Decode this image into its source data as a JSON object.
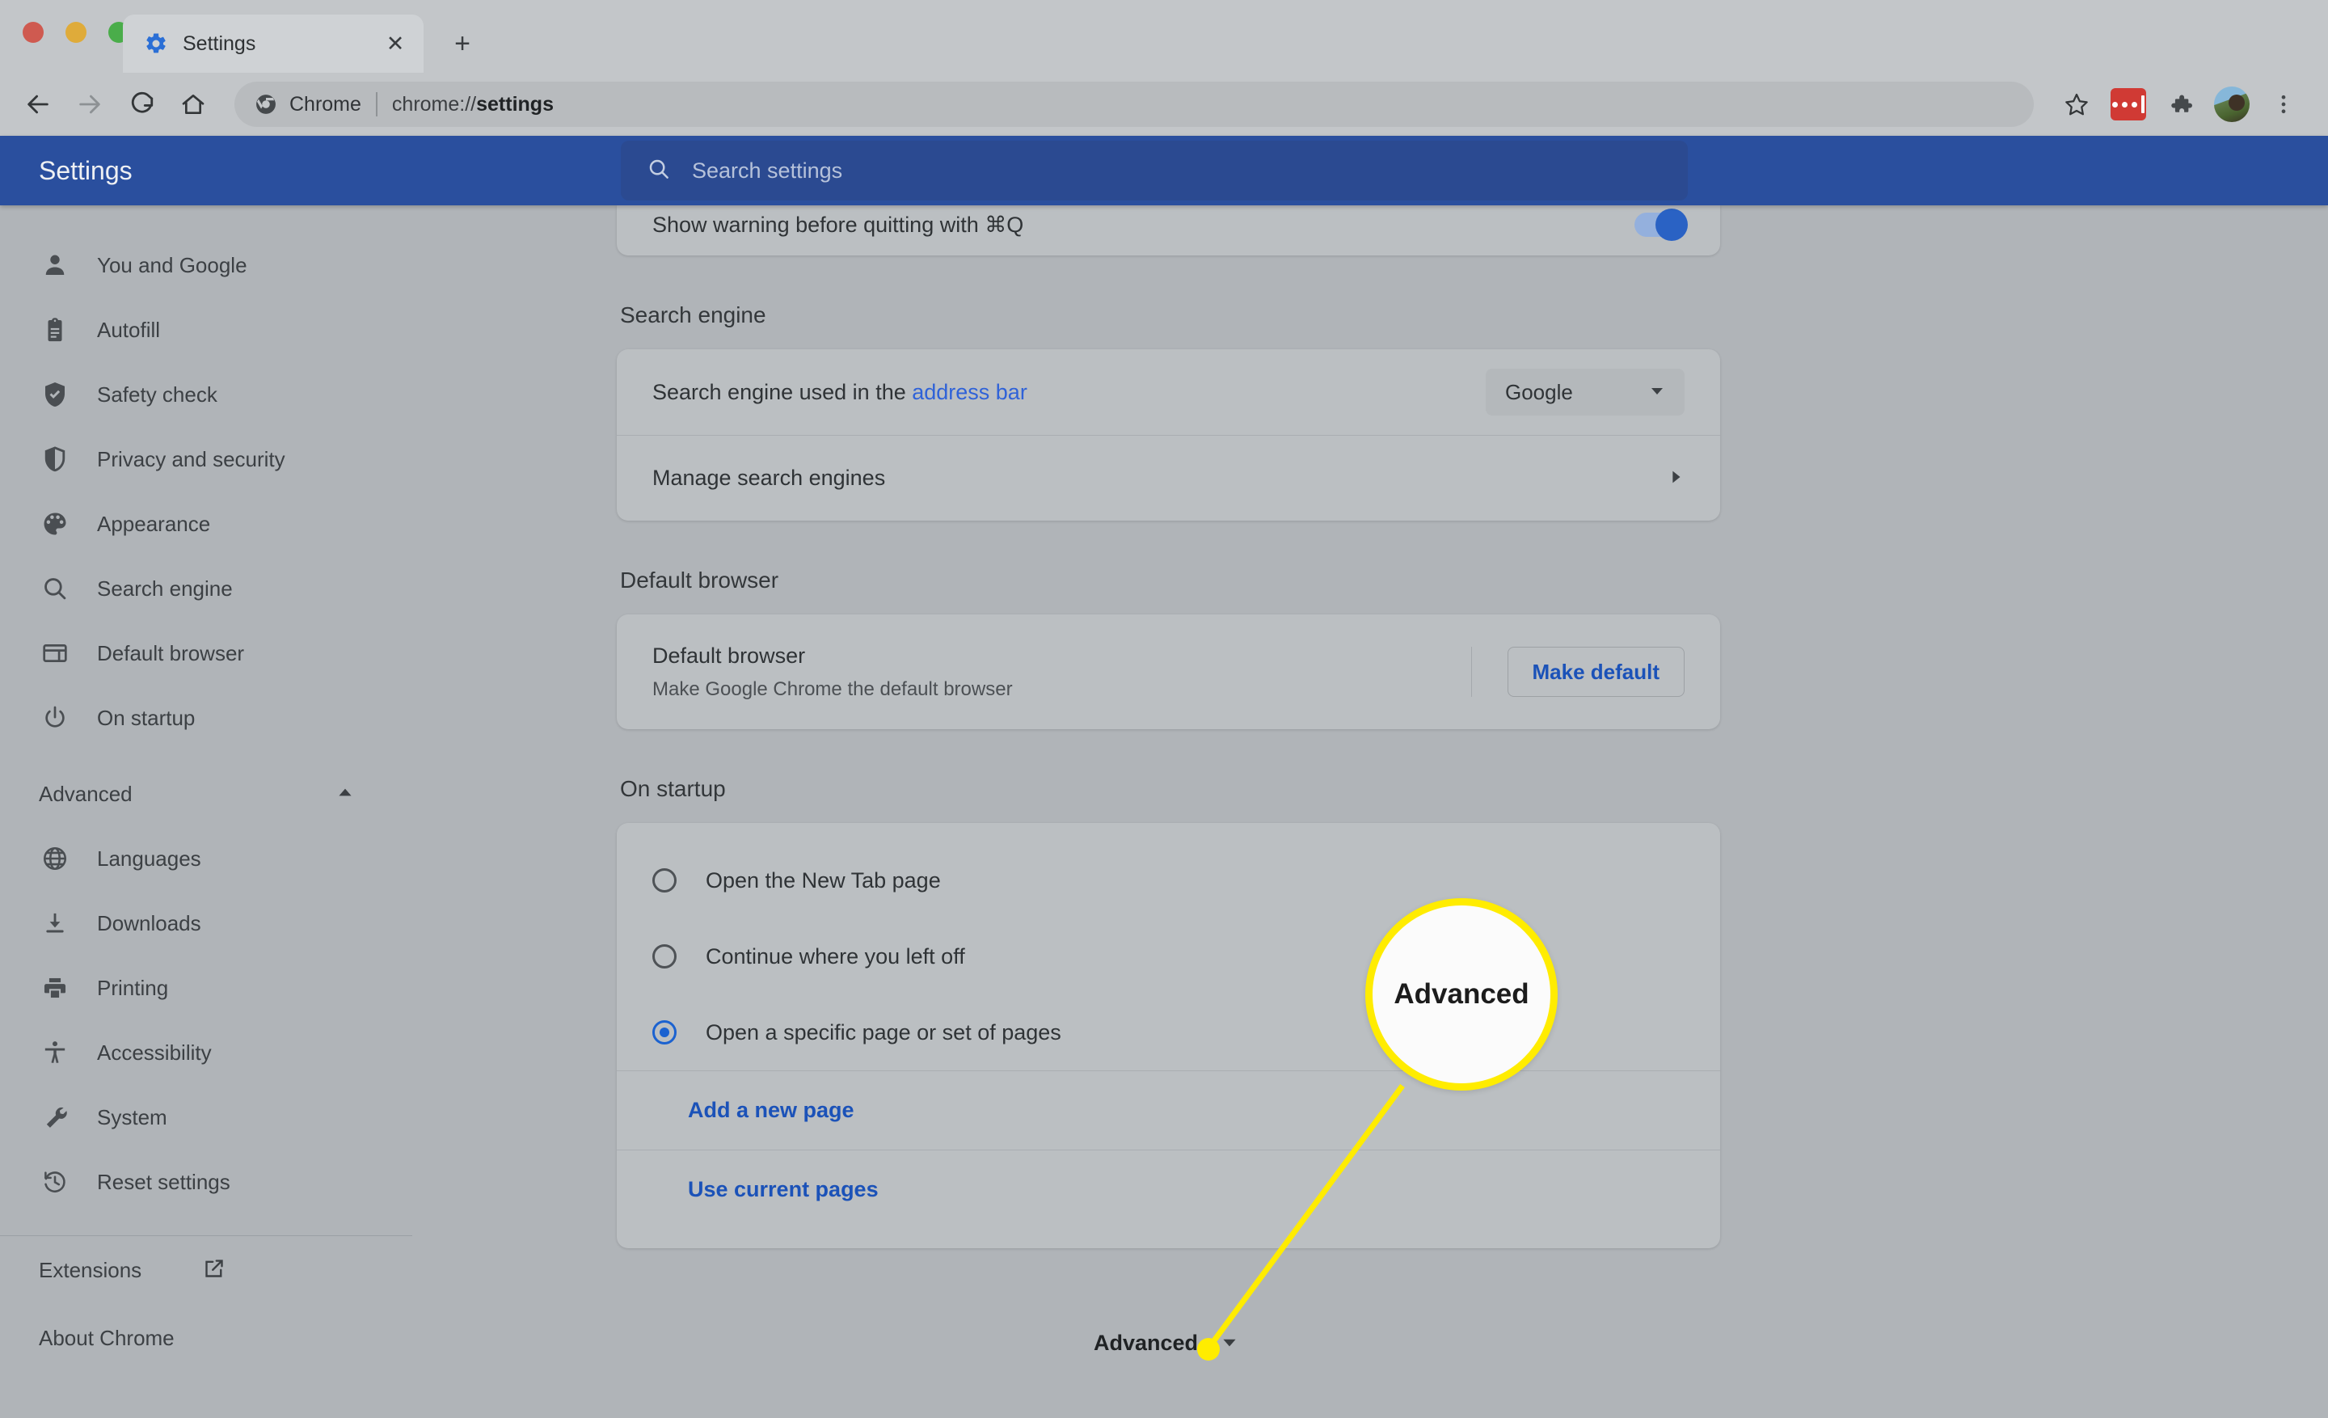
{
  "window": {
    "traffic_lights": [
      "close",
      "minimize",
      "maximize"
    ]
  },
  "tab": {
    "title": "Settings",
    "favicon": "gear-icon",
    "close_label": "✕",
    "newtab_label": "+"
  },
  "toolbar": {
    "back": "←",
    "forward": "→",
    "reload": "⟳",
    "home": "⌂",
    "omnibox": {
      "brand_icon": "chrome-icon",
      "brand": "Chrome",
      "url_prefix": "chrome://",
      "url_bold": "settings"
    },
    "bookmark_star": "☆",
    "extension_red": "red-extension-icon",
    "extensions_puzzle": "puzzle-icon",
    "avatar": "profile-avatar",
    "menu": "three-dot-menu"
  },
  "settings_header": {
    "title": "Settings",
    "search_icon": "search-icon",
    "search_placeholder": "Search settings",
    "search_value": ""
  },
  "sidebar": {
    "items": [
      {
        "label": "You and Google",
        "icon": "person-icon"
      },
      {
        "label": "Autofill",
        "icon": "clipboard-icon"
      },
      {
        "label": "Safety check",
        "icon": "shield-check-icon"
      },
      {
        "label": "Privacy and security",
        "icon": "shield-icon"
      },
      {
        "label": "Appearance",
        "icon": "palette-icon"
      },
      {
        "label": "Search engine",
        "icon": "search-icon"
      },
      {
        "label": "Default browser",
        "icon": "browser-window-icon"
      },
      {
        "label": "On startup",
        "icon": "power-icon"
      }
    ],
    "advanced_group": {
      "label": "Advanced",
      "expanded": true,
      "chevron": "chevron-up-icon",
      "items": [
        {
          "label": "Languages",
          "icon": "globe-icon"
        },
        {
          "label": "Downloads",
          "icon": "download-icon"
        },
        {
          "label": "Printing",
          "icon": "printer-icon"
        },
        {
          "label": "Accessibility",
          "icon": "accessibility-icon"
        },
        {
          "label": "System",
          "icon": "wrench-icon"
        },
        {
          "label": "Reset settings",
          "icon": "history-restore-icon"
        }
      ]
    },
    "footer_items": [
      {
        "label": "Extensions",
        "icon": "external-link-icon"
      },
      {
        "label": "About Chrome",
        "icon": ""
      }
    ]
  },
  "main": {
    "clipped_row": {
      "label": "Show warning before quitting with ⌘Q",
      "toggle_on": true
    },
    "search_engine": {
      "title": "Search engine",
      "row_label_prefix": "Search engine used in the ",
      "row_label_link": "address bar",
      "selected": "Google",
      "dropdown_icon": "chevron-down-icon",
      "manage_label": "Manage search engines",
      "manage_chevron": "chevron-right-icon"
    },
    "default_browser": {
      "title": "Default browser",
      "row_title": "Default browser",
      "row_sub": "Make Google Chrome the default browser",
      "button_label": "Make default"
    },
    "on_startup": {
      "title": "On startup",
      "options": [
        {
          "label": "Open the New Tab page",
          "selected": false
        },
        {
          "label": "Continue where you left off",
          "selected": false
        },
        {
          "label": "Open a specific page or set of pages",
          "selected": true
        }
      ],
      "links": [
        {
          "label": "Add a new page"
        },
        {
          "label": "Use current pages"
        }
      ]
    }
  },
  "annotation": {
    "bubble_text": "Advanced",
    "footer_label": "Advanced",
    "footer_chevron": "chevron-down-icon",
    "highlight_color": "#ffec00"
  }
}
